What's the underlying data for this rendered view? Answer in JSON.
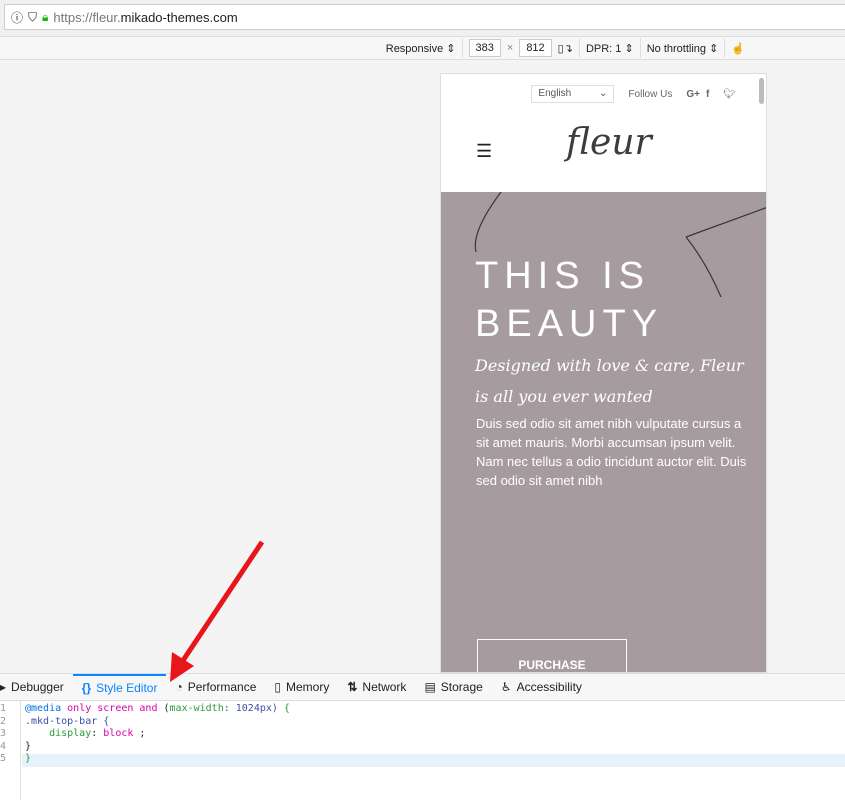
{
  "browser": {
    "url_prefix": "https://fleur.",
    "url_domain": "mikado-themes.com"
  },
  "rdm": {
    "device": "Responsive",
    "width": "383",
    "x": "×",
    "height": "812",
    "dpr": "DPR: 1",
    "throttling": "No throttling"
  },
  "site": {
    "language": "English",
    "follow": "Follow Us",
    "logo": "fleur",
    "hero_line1": "THIS IS",
    "hero_line2": "BEAUTY",
    "subtitle": "Designed with love & care, Fleur is all you ever wanted",
    "body": "Duis sed odio sit amet nibh vulputate cursus a sit amet mauris. Morbi accumsan ipsum velit. Nam nec tellus a odio tincidunt auctor elit. Duis sed odio sit amet nibh",
    "button": "PURCHASE"
  },
  "devtools": {
    "tabs": [
      {
        "label": "Debugger"
      },
      {
        "label": "Style Editor"
      },
      {
        "label": "Performance"
      },
      {
        "label": "Memory"
      },
      {
        "label": "Network"
      },
      {
        "label": "Storage"
      },
      {
        "label": "Accessibility"
      }
    ],
    "lines": [
      "1",
      "2",
      "3",
      "4",
      "5"
    ],
    "code": {
      "l1a": "@media",
      "l1b": "only screen and",
      "l1c": "(",
      "l1d": "max-width",
      "l1e": ": 1024px)",
      "l1f": " {",
      "l2": ".mkd-top-bar {",
      "l3a": "    display",
      "l3b": ": ",
      "l3c": "block",
      "l3d": " ;",
      "l4": "}",
      "l5": "}"
    }
  },
  "colors": {
    "accent": "#0a84ff",
    "hero": "#a69c9f",
    "arrow": "#e8151b"
  }
}
